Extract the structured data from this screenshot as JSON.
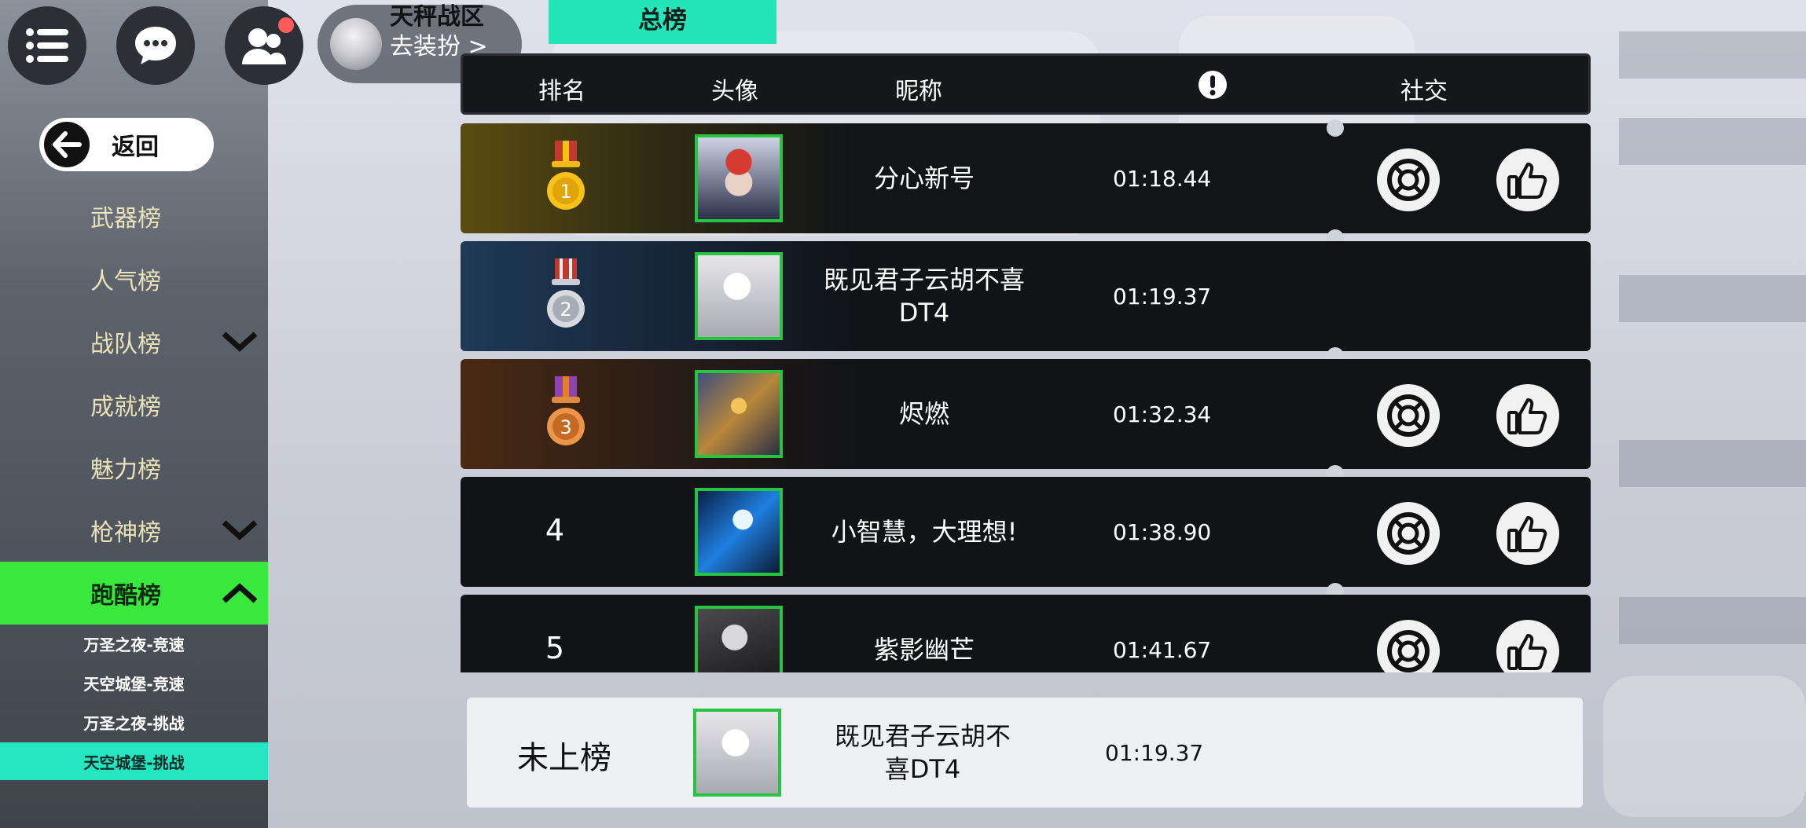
{
  "top_bar": {
    "dress_up_label": "去装扮 >",
    "zone_tab": "天秤战区",
    "main_tab": "总榜"
  },
  "sidebar": {
    "back_label": "返回",
    "items": [
      {
        "label": "武器榜",
        "expandable": false
      },
      {
        "label": "人气榜",
        "expandable": false
      },
      {
        "label": "战队榜",
        "expandable": true
      },
      {
        "label": "成就榜",
        "expandable": false
      },
      {
        "label": "魅力榜",
        "expandable": false
      },
      {
        "label": "枪神榜",
        "expandable": true
      },
      {
        "label": "跑酷榜",
        "expandable": true,
        "active": true
      }
    ],
    "sub_items": [
      {
        "label": "万圣之夜-竞速"
      },
      {
        "label": "天空城堡-竞速"
      },
      {
        "label": "万圣之夜-挑战"
      },
      {
        "label": "天空城堡-挑战",
        "active": true
      }
    ]
  },
  "table": {
    "headers": {
      "rank": "排名",
      "avatar": "头像",
      "nickname": "昵称",
      "social": "社交"
    },
    "rows": [
      {
        "rank": "1",
        "medal": "gold",
        "name": "分心新号",
        "time": "01:18.44",
        "social": true
      },
      {
        "rank": "2",
        "medal": "silver",
        "name": "既见君子云胡不喜\nDT4",
        "time": "01:19.37",
        "social": false
      },
      {
        "rank": "3",
        "medal": "bronze",
        "name": "烬燃",
        "time": "01:32.34",
        "social": true
      },
      {
        "rank": "4",
        "medal": null,
        "name": "小智慧，大理想!",
        "time": "01:38.90",
        "social": true
      },
      {
        "rank": "5",
        "medal": null,
        "name": "紫影幽芒",
        "time": "01:41.67",
        "social": true
      }
    ]
  },
  "my_entry": {
    "rank_text": "未上榜",
    "name": "既见君子云胡不\n喜DT4",
    "time": "01:19.37"
  },
  "colors": {
    "accent_green": "#39e83d",
    "accent_teal": "#24e5b8",
    "avatar_border": "#29c342"
  }
}
